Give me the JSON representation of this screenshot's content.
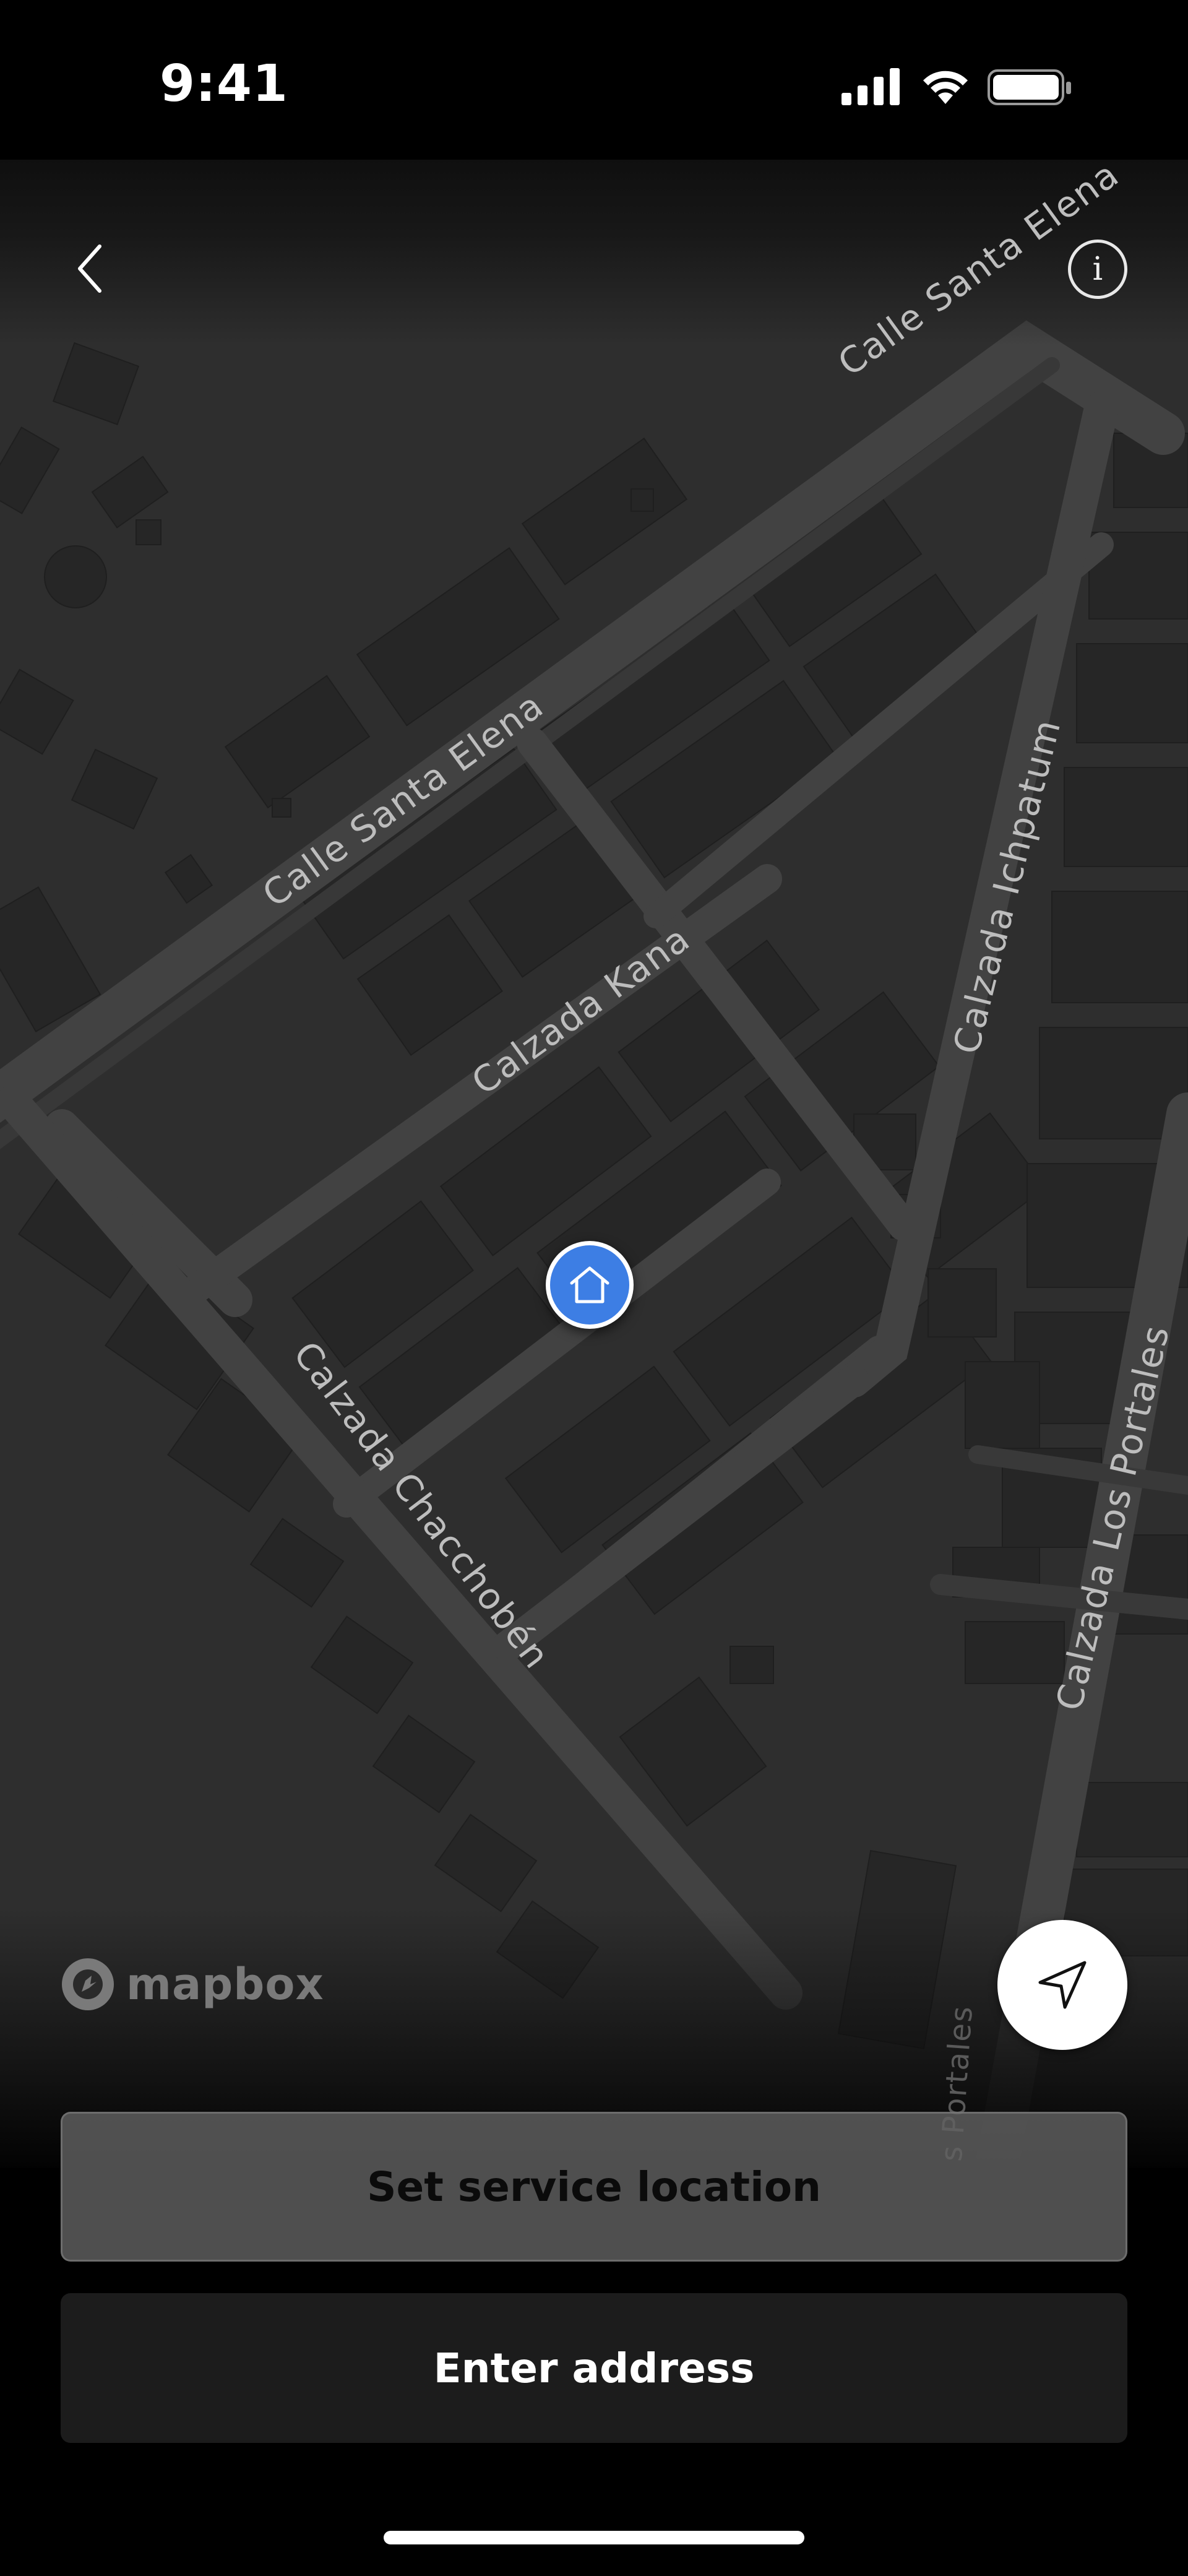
{
  "status_bar": {
    "time": "9:41"
  },
  "map": {
    "attribution": "mapbox",
    "streets": [
      "Calle Santa Elena",
      "Calle Santa Elena",
      "Calzada Kana",
      "Calzada Ichpatum",
      "Calzada Chacchobén",
      "Calzada Los Portales",
      "s Portales"
    ],
    "pin_icon": "home-icon"
  },
  "header": {
    "back_icon": "chevron-left-icon",
    "info_icon": "info-icon",
    "info_glyph": "i"
  },
  "controls": {
    "locate_icon": "navigation-arrow-icon"
  },
  "actions": {
    "set_service_location": "Set service location",
    "enter_address": "Enter address"
  },
  "colors": {
    "pin": "#3d7ee4",
    "map_background": "#2e2e2e",
    "road": "#444444",
    "building": "#262626"
  }
}
